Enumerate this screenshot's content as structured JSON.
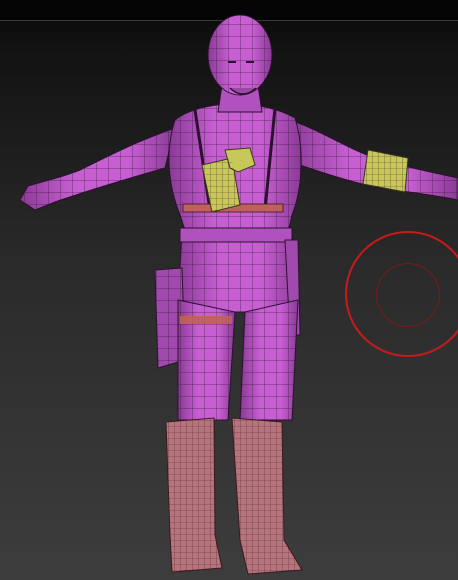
{
  "viewport": {
    "model_name": "",
    "colors": {
      "background_top": "#070707",
      "background_bottom": "#3d3d3d",
      "skin_polygroup": "#c75fd2",
      "skin_shadow": "#8a3a96",
      "wireframe": "#2c1030",
      "holster_polygroup": "#c8c85a",
      "boots_polygroup": "#b8747c",
      "belt_stripe": "#c0605a",
      "brush_outer": "#c81a1a",
      "brush_inner": "#7a1a1a"
    },
    "icons": {
      "brush_cursor": "brush-cursor-icon"
    }
  }
}
